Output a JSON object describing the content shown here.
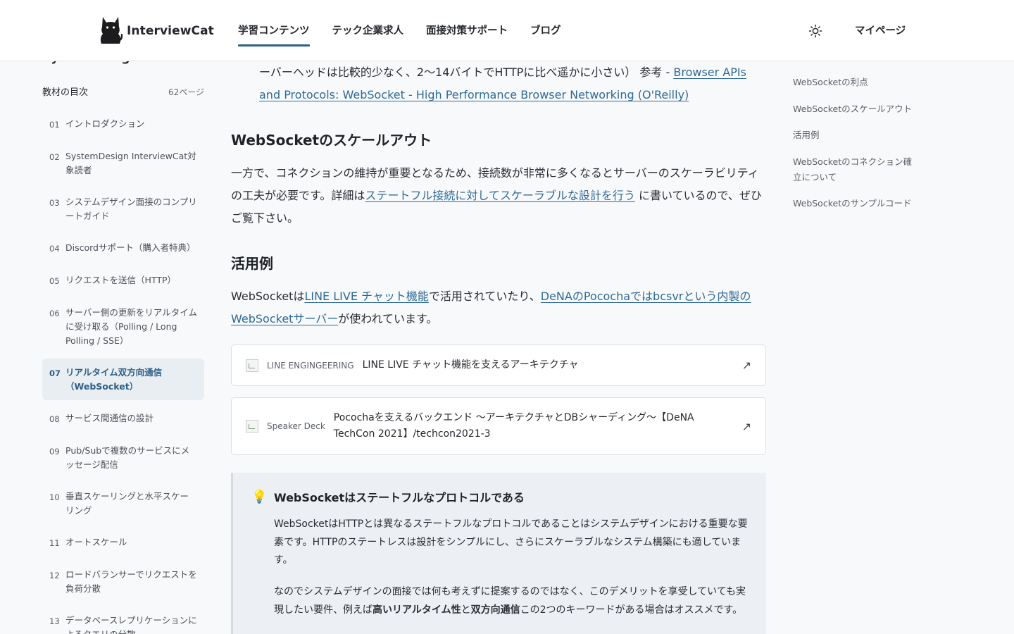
{
  "header": {
    "logo_text": "InterviewCat",
    "nav": [
      "学習コンテンツ",
      "テック企業求人",
      "面接対策サポート",
      "ブログ"
    ],
    "mypage": "マイページ"
  },
  "sidebar": {
    "title": "SystemDesign InterviewCat",
    "toc_label": "教材の目次",
    "page_count": "62ページ",
    "items": [
      {
        "num": "01",
        "title": "イントロダクション"
      },
      {
        "num": "02",
        "title": "SystemDesign InterviewCat対象読者"
      },
      {
        "num": "03",
        "title": "システムデザイン面接のコンプリートガイド"
      },
      {
        "num": "04",
        "title": "Discordサポート（購入者特典）"
      },
      {
        "num": "05",
        "title": "リクエストを送信（HTTP）"
      },
      {
        "num": "06",
        "title": "サーバー側の更新をリアルタイムに受け取る（Polling / Long Polling / SSE）"
      },
      {
        "num": "07",
        "title": "リアルタイム双方向通信（WebSocket）"
      },
      {
        "num": "08",
        "title": "サービス間通信の設計"
      },
      {
        "num": "09",
        "title": "Pub/Subで複数のサービスにメッセージ配信"
      },
      {
        "num": "10",
        "title": "垂直スケーリングと水平スケーリング"
      },
      {
        "num": "11",
        "title": "オートスケール"
      },
      {
        "num": "12",
        "title": "ロードバランサーでリクエストを負荷分散"
      },
      {
        "num": "13",
        "title": "データベースレプリケーションによるクエリの分散"
      }
    ]
  },
  "main": {
    "top_text": "ーバーヘッドは比較的少なく、2〜14バイトでHTTPに比べ遥かに小さい） 参考 - ",
    "top_link": "Browser APIs and Protocols: WebSocket - High Performance Browser Networking (O'Reilly)",
    "h_scaleout": "WebSocketのスケールアウト",
    "scaleout_pre": "一方で、コネクションの維持が重要となるため、接続数が非常に多くなるとサーバーのスケーラビリティの工夫が必要です。詳細は",
    "scaleout_link": "ステートフル接続に対してスケーラブルな設計を行う",
    "scaleout_post": " に書いているので、ぜひご覧下さい。",
    "h_usecase": "活用例",
    "usecase_pre": "WebSocketは",
    "usecase_link1": "LINE LIVE チャット機能",
    "usecase_mid": "で活用されていたり、",
    "usecase_link2": "DeNAのPocochaではbcsvrという内製のWebSocketサーバー",
    "usecase_post": "が使われています。",
    "cards": [
      {
        "site": "LINE ENGINGEERING",
        "title": "LINE LIVE チャット機能を支えるアーキテクチャ"
      },
      {
        "site": "Speaker Deck",
        "title": "Pocochaを支えるバックエンド 〜アーキテクチャとDBシャーディング〜【DeNA TechCon 2021】/techcon2021-3"
      }
    ],
    "callout": {
      "title": "WebSocketはステートフルなプロトコルである",
      "p1": "WebSocketはHTTPとは異なるステートフルなプロトコルであることはシステムデザインにおける重要な要素です。HTTPのステートレスは設計をシンプルにし、さらにスケーラブルなシステム構築にも適しています。",
      "p2_pre": "なのでシステムデザインの面接では何も考えずに提案するのではなく、このデメリットを享受していても実現したい要件、例えば",
      "p2_bold1": "高いリアルタイム性",
      "p2_and": "と",
      "p2_bold2": "双方向通信",
      "p2_post": "この2つのキーワードがある場合はオススメです。"
    }
  },
  "right_toc": [
    "WebSocketの利点",
    "WebSocketのスケールアウト",
    "活用例",
    "WebSocketのコネクション確立について",
    "WebSocketのサンプルコード"
  ],
  "colors": {
    "accent": "#2e5f86",
    "link": "#2e6a96",
    "callout_bg": "#eceff3"
  }
}
